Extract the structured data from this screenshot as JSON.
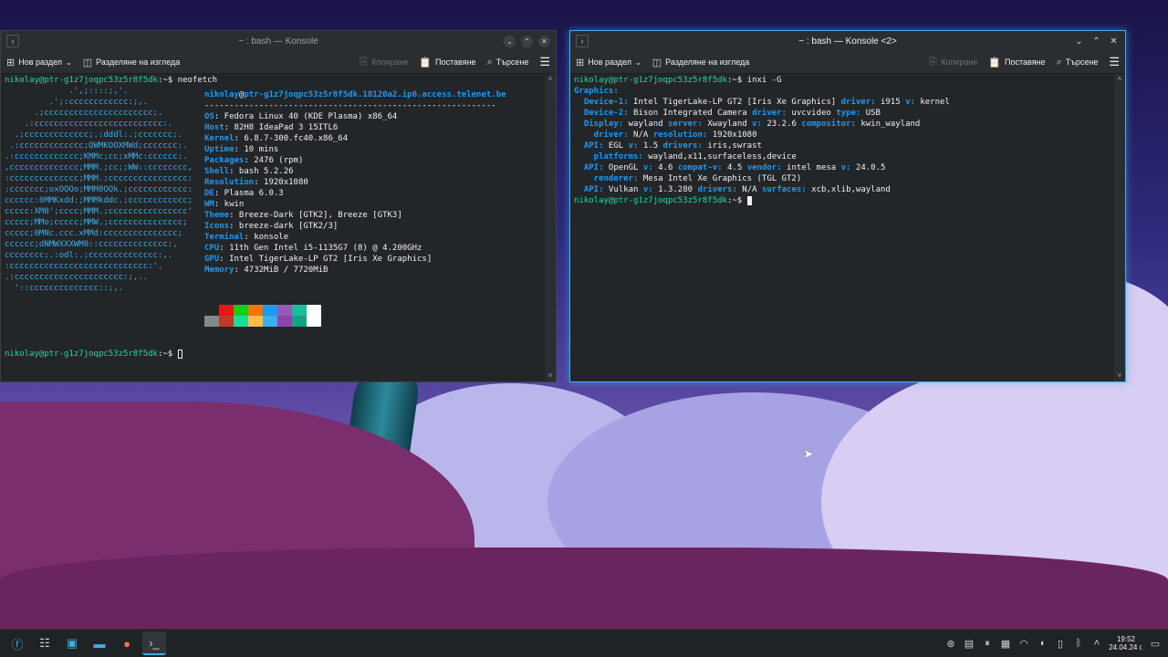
{
  "left_window": {
    "title": "~ : bash — Konsole",
    "toolbar": {
      "new_tab": "Нов раздел",
      "split": "Разделяне на изгледа",
      "copy": "Копиране",
      "paste": "Поставяне",
      "search": "Търсене"
    },
    "prompt_user": "nikolay@ptr-g1z7joqpc53z5r8f5dk",
    "command": "neofetch",
    "logo_lines": [
      "             .',;::::;,'.",
      "         .';:cccccccccccc:;,.",
      "      .;cccccccccccccccccccccc;.",
      "    .:cccccccccccccccccccccccccc:.",
      "  .;ccccccccccccc;.:dddl:.;ccccccc;.",
      " .:ccccccccccccc;OWMKOOXMWd;ccccccc:.",
      ".:ccccccccccccc;KMMc;cc;xMMc:cccccc:.",
      ",cccccccccccccc;MMM.;cc;;WW::cccccccc,",
      ":cccccccccccccc;MMM.;cccccccccccccccc:",
      ":ccccccc;oxOOOo;MMM0OOk.;cccccccccccc:",
      "cccccc:0MMKxdd:;MMMkddc.;cccccccccccc;",
      "ccccc:XM0';cccc;MMM.;cccccccccccccccc'",
      "ccccc;MMo;ccccc;MMW.;ccccccccccccccc;",
      "ccccc;0MNc.ccc.xMMd:ccccccccccccccc;",
      "cccccc;dNMWXXXWM0::cccccccccccccc:,",
      "cccccccc;.:odl:.;cccccccccccccc:,.",
      ":cccccccccccccccccccccccccccc:'.",
      ".:cccccccccccccccccccccc:;,..",
      "  '::cccccccccccccc::;,."
    ],
    "host_line": "nikolay@ptr-g1z7joqpc53z5r8f5dk.18120a2.ip6.access.telenet.be",
    "separator": "-----------------------------------------------------------",
    "info": [
      {
        "k": "OS",
        "v": "Fedora Linux 40 (KDE Plasma) x86_64"
      },
      {
        "k": "Host",
        "v": "82H8 IdeaPad 3 15ITL6"
      },
      {
        "k": "Kernel",
        "v": "6.8.7-300.fc40.x86_64"
      },
      {
        "k": "Uptime",
        "v": "10 mins"
      },
      {
        "k": "Packages",
        "v": "2476 (rpm)"
      },
      {
        "k": "Shell",
        "v": "bash 5.2.26"
      },
      {
        "k": "Resolution",
        "v": "1920x1080"
      },
      {
        "k": "DE",
        "v": "Plasma 6.0.3"
      },
      {
        "k": "WM",
        "v": "kwin"
      },
      {
        "k": "Theme",
        "v": "Breeze-Dark [GTK2], Breeze [GTK3]"
      },
      {
        "k": "Icons",
        "v": "breeze-dark [GTK2/3]"
      },
      {
        "k": "Terminal",
        "v": "konsole"
      },
      {
        "k": "CPU",
        "v": "11th Gen Intel i5-1135G7 (8) @ 4.200GHz"
      },
      {
        "k": "GPU",
        "v": "Intel TigerLake-LP GT2 [Iris Xe Graphics]"
      },
      {
        "k": "Memory",
        "v": "4732MiB / 7720MiB"
      }
    ],
    "palette_top": [
      "#232629",
      "#ed1515",
      "#11d116",
      "#f67400",
      "#1d99f3",
      "#9b59b6",
      "#1abc9c",
      "#fcfcfc"
    ],
    "palette_bottom": [
      "#7f8c8d",
      "#c0392b",
      "#1cdc9a",
      "#fdbc4b",
      "#3daee9",
      "#8e44ad",
      "#16a085",
      "#ffffff"
    ]
  },
  "right_window": {
    "title": "~ : bash — Konsole <2>",
    "toolbar": {
      "new_tab": "Нов раздел",
      "split": "Разделяне на изгледа",
      "copy": "Копиране",
      "paste": "Поставяне",
      "search": "Търсене"
    },
    "prompt_user": "nikolay@ptr-g1z7joqpc53z5r8f5dk",
    "command": "inxi -G",
    "lines": [
      [
        {
          "t": "Graphics:",
          "c": "b"
        }
      ],
      [
        {
          "t": "  Device-1:",
          "c": "b"
        },
        {
          "t": " Intel TigerLake-LP GT2 [Iris Xe Graphics] ",
          "c": "w"
        },
        {
          "t": "driver:",
          "c": "b"
        },
        {
          "t": " i915 ",
          "c": "w"
        },
        {
          "t": "v:",
          "c": "b"
        },
        {
          "t": " kernel",
          "c": "w"
        }
      ],
      [
        {
          "t": "  Device-2:",
          "c": "b"
        },
        {
          "t": " Bison Integrated Camera ",
          "c": "w"
        },
        {
          "t": "driver:",
          "c": "b"
        },
        {
          "t": " uvcvideo ",
          "c": "w"
        },
        {
          "t": "type:",
          "c": "b"
        },
        {
          "t": " USB",
          "c": "w"
        }
      ],
      [
        {
          "t": "  Display:",
          "c": "b"
        },
        {
          "t": " wayland ",
          "c": "w"
        },
        {
          "t": "server:",
          "c": "b"
        },
        {
          "t": " Xwayland ",
          "c": "w"
        },
        {
          "t": "v:",
          "c": "b"
        },
        {
          "t": " 23.2.6 ",
          "c": "w"
        },
        {
          "t": "compositor:",
          "c": "b"
        },
        {
          "t": " kwin_wayland",
          "c": "w"
        }
      ],
      [
        {
          "t": "    driver:",
          "c": "b"
        },
        {
          "t": " N/A ",
          "c": "w"
        },
        {
          "t": "resolution:",
          "c": "b"
        },
        {
          "t": " 1920x1080",
          "c": "w"
        }
      ],
      [
        {
          "t": "  API:",
          "c": "b"
        },
        {
          "t": " EGL ",
          "c": "w"
        },
        {
          "t": "v:",
          "c": "b"
        },
        {
          "t": " 1.5 ",
          "c": "w"
        },
        {
          "t": "drivers:",
          "c": "b"
        },
        {
          "t": " iris,swrast",
          "c": "w"
        }
      ],
      [
        {
          "t": "    platforms:",
          "c": "b"
        },
        {
          "t": " wayland,x11,surfaceless,device",
          "c": "w"
        }
      ],
      [
        {
          "t": "  API:",
          "c": "b"
        },
        {
          "t": " OpenGL ",
          "c": "w"
        },
        {
          "t": "v:",
          "c": "b"
        },
        {
          "t": " 4.6 ",
          "c": "w"
        },
        {
          "t": "compat-v:",
          "c": "b"
        },
        {
          "t": " 4.5 ",
          "c": "w"
        },
        {
          "t": "vendor:",
          "c": "b"
        },
        {
          "t": " intel mesa ",
          "c": "w"
        },
        {
          "t": "v:",
          "c": "b"
        },
        {
          "t": " 24.0.5",
          "c": "w"
        }
      ],
      [
        {
          "t": "    renderer:",
          "c": "b"
        },
        {
          "t": " Mesa Intel Xe Graphics (TGL GT2)",
          "c": "w"
        }
      ],
      [
        {
          "t": "  API:",
          "c": "b"
        },
        {
          "t": " Vulkan ",
          "c": "w"
        },
        {
          "t": "v:",
          "c": "b"
        },
        {
          "t": " 1.3.280 ",
          "c": "w"
        },
        {
          "t": "drivers:",
          "c": "b"
        },
        {
          "t": " N/A ",
          "c": "w"
        },
        {
          "t": "surfaces:",
          "c": "b"
        },
        {
          "t": " xcb,xlib,wayland",
          "c": "w"
        }
      ]
    ]
  },
  "taskbar": {
    "apps": [
      "fedora-launcher-icon",
      "system-settings-icon",
      "discover-icon",
      "dolphin-icon",
      "firefox-icon",
      "konsole-icon"
    ],
    "clock_time": "19:52",
    "clock_date": "24.04.24 г."
  }
}
